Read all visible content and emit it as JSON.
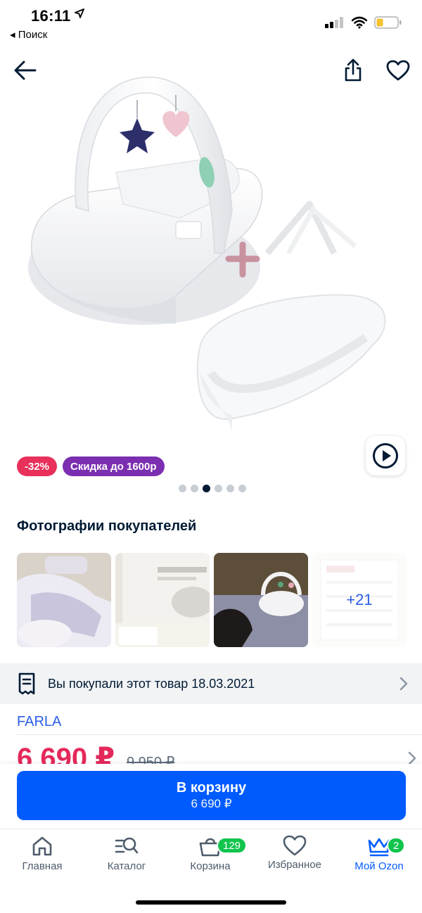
{
  "status_bar": {
    "time": "16:11",
    "back_app": "◂ Поиск"
  },
  "nav": {
    "back_icon": "arrow-left-icon",
    "share_icon": "share-icon",
    "fav_icon": "heart-icon"
  },
  "product": {
    "badges": {
      "discount": "-32%",
      "promo": "Скидка до 1600р"
    },
    "gallery": {
      "slides": 6,
      "active_index": 2
    },
    "video_icon": "play-icon"
  },
  "customer_photos": {
    "title": "Фотографии покупателей",
    "more_label": "+21"
  },
  "purchased": {
    "text": "Вы покупали этот товар 18.03.2021"
  },
  "brand": "FARLA",
  "price": {
    "current": "6 690 ₽",
    "old": "9 950 ₽"
  },
  "cart_button": {
    "label": "В корзину",
    "price": "6 690 ₽"
  },
  "tabbar": {
    "items": [
      {
        "label": "Главная",
        "icon": "home-icon"
      },
      {
        "label": "Каталог",
        "icon": "catalog-icon"
      },
      {
        "label": "Корзина",
        "icon": "cart-icon",
        "count": "129"
      },
      {
        "label": "Избранное",
        "icon": "heart-icon"
      },
      {
        "label": "Мой Ozon",
        "icon": "crown-icon",
        "count": "2"
      }
    ]
  },
  "colors": {
    "accent": "#005bff",
    "price": "#e4295a",
    "promo": "#7b2fb0",
    "count": "#10c44c"
  }
}
